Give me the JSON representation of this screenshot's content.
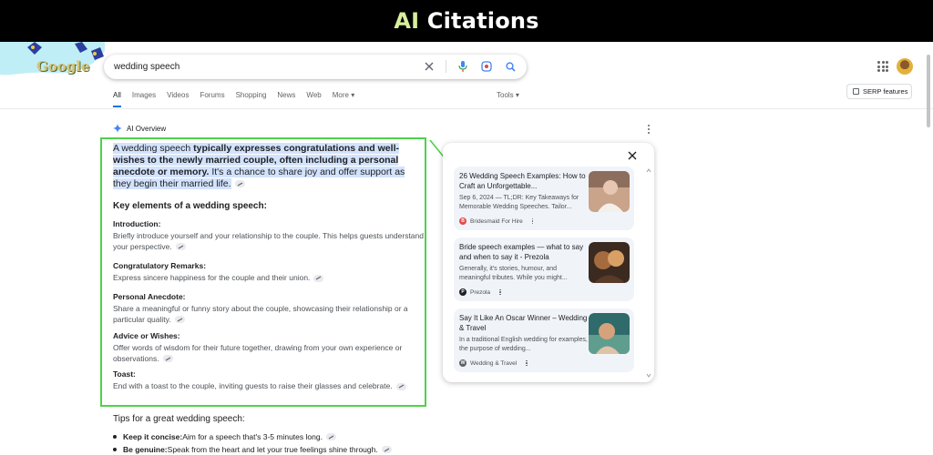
{
  "banner": {
    "title_accent": "AI",
    "title_rest": " Citations"
  },
  "logo": {
    "text": "Google"
  },
  "search": {
    "value": "wedding speech"
  },
  "tabs": [
    {
      "label": "All",
      "active": true
    },
    {
      "label": "Images"
    },
    {
      "label": "Videos"
    },
    {
      "label": "Forums"
    },
    {
      "label": "Shopping"
    },
    {
      "label": "News"
    },
    {
      "label": "Web"
    },
    {
      "label": "More"
    }
  ],
  "tools_label": "Tools",
  "serp_label": "SERP features",
  "overview": {
    "label": "AI Overview",
    "summary_highlight": "A wedding speech",
    "summary_bold": " typically expresses congratulations and well-wishes to the newly married couple, often including a personal anecdote or memory.",
    "summary_rest": " It's a chance to share joy and offer support as they begin their married life.",
    "key_heading": "Key elements of a wedding speech:",
    "sections": [
      {
        "title": "Introduction:",
        "text": "Briefly introduce yourself and your relationship to the couple. This helps guests understand your perspective."
      },
      {
        "title": "Congratulatory Remarks:",
        "text": "Express sincere happiness for the couple and their union."
      },
      {
        "title": "Personal Anecdote:",
        "text": "Share a meaningful or funny story about the couple, showcasing their relationship or a particular quality."
      },
      {
        "title": "Advice or Wishes:",
        "text": "Offer words of wisdom for their future together, drawing from your own experience or observations."
      },
      {
        "title": "Toast:",
        "text": "End with a toast to the couple, inviting guests to raise their glasses and celebrate."
      }
    ],
    "tips_heading": "Tips for a great wedding speech:",
    "tips": [
      {
        "bold": "Keep it concise:",
        "text": " Aim for a speech that's 3-5 minutes long."
      },
      {
        "bold": "Be genuine:",
        "text": " Speak from the heart and let your true feelings shine through."
      }
    ]
  },
  "citations": [
    {
      "title": "26 Wedding Speech Examples: How to Craft an Unforgettable...",
      "snippet": "Sep 6, 2024 — TL;DR: Key Takeaways for Memorable Wedding Speeches. Tailor...",
      "source": "Bridesmaid For Hire",
      "source_icon_color": "#e24b4b"
    },
    {
      "title": "Bride speech examples — what to say and when to say it - Prezola",
      "snippet": "Generally, it's stories, humour, and meaningful tributes. While you might...",
      "source": "Prezola",
      "source_icon_color": "#202124"
    },
    {
      "title": "Say It Like An Oscar Winner – Wedding & Travel",
      "snippet": "In a traditional English wedding for examples, the purpose of wedding...",
      "source": "Wedding & Travel",
      "source_icon_color": "#5f6368"
    }
  ],
  "colors": {
    "highlight": "#4fd14a",
    "accent_link": "#1a73e8",
    "banner_accent": "#d7ef9d"
  }
}
